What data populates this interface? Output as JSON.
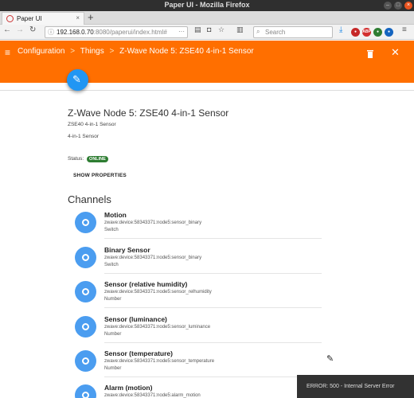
{
  "window": {
    "title": "Paper UI - Mozilla Firefox"
  },
  "tab": {
    "title": "Paper UI"
  },
  "nav": {
    "url_host": "192.168.0.70",
    "url_rest": ":8080/paperui/index.html#",
    "search_placeholder": "Search"
  },
  "header": {
    "crumbs": [
      "Configuration",
      "Things",
      "Z-Wave Node 5: ZSE40 4-in-1 Sensor"
    ],
    "separator": ">",
    "bg_color": "#ff6f00"
  },
  "thing": {
    "title": "Z-Wave Node 5: ZSE40 4-in-1 Sensor",
    "subtitle1": "ZSE40 4-in-1 Sensor",
    "subtitle2": "4-in-1 Sensor",
    "status_label": "Status:",
    "status": "ONLINE",
    "show_properties": "SHOW PROPERTIES"
  },
  "channels": {
    "heading": "Channels",
    "items": [
      {
        "name": "Motion",
        "uid": "zwave:device:58343371:node5:sensor_binary",
        "type": "Switch"
      },
      {
        "name": "Binary Sensor",
        "uid": "zwave:device:58343371:node5:sensor_binary",
        "type": "Switch"
      },
      {
        "name": "Sensor (relative humidity)",
        "uid": "zwave:device:58343371:node5:sensor_relhumidity",
        "type": "Number"
      },
      {
        "name": "Sensor (luminance)",
        "uid": "zwave:device:58343371:node5:sensor_luminance",
        "type": "Number"
      },
      {
        "name": "Sensor (temperature)",
        "uid": "zwave:device:58343371:node5:sensor_temperature",
        "type": "Number"
      },
      {
        "name": "Alarm (motion)",
        "uid": "zwave:device:58343371:node5:alarm_motion",
        "type": ""
      }
    ]
  },
  "toast": {
    "message": "ERROR: 500 - Internal Server Error"
  }
}
